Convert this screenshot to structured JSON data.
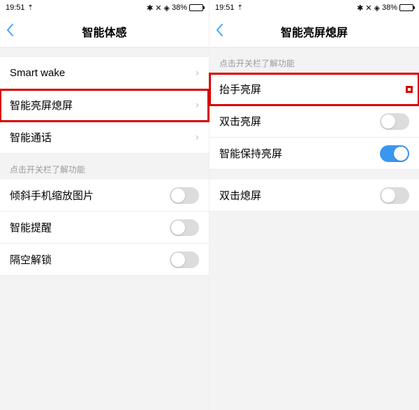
{
  "status": {
    "time": "19:51",
    "battery_text": "38%"
  },
  "left": {
    "title": "智能体感",
    "rows_nav": [
      {
        "label": "Smart wake"
      },
      {
        "label": "智能亮屏熄屏",
        "highlight": true
      },
      {
        "label": "智能通话"
      }
    ],
    "hint": "点击开关栏了解功能",
    "rows_toggle": [
      {
        "label": "倾斜手机缩放图片",
        "on": false
      },
      {
        "label": "智能提醒",
        "on": false
      },
      {
        "label": "隔空解锁",
        "on": false
      }
    ]
  },
  "right": {
    "title": "智能亮屏熄屏",
    "hint": "点击开关栏了解功能",
    "rows_top": [
      {
        "label": "抬手亮屏",
        "on": true,
        "highlight": true
      },
      {
        "label": "双击亮屏",
        "on": false
      },
      {
        "label": "智能保持亮屏",
        "on": true
      }
    ],
    "rows_bottom": [
      {
        "label": "双击熄屏",
        "on": false
      }
    ]
  }
}
